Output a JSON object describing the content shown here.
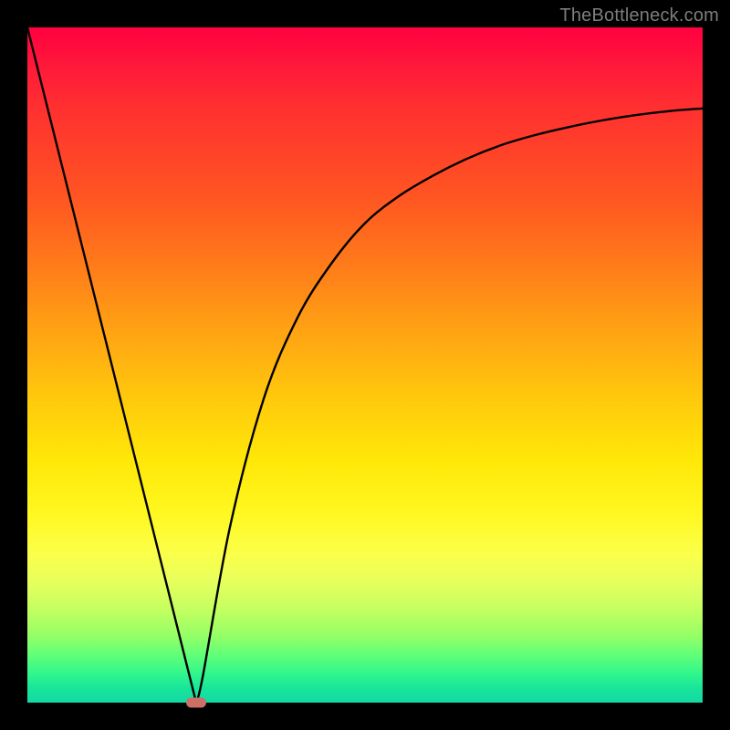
{
  "watermark": "TheBottleneck.com",
  "chart_data": {
    "type": "line",
    "title": "",
    "xlabel": "",
    "ylabel": "",
    "xlim": [
      0,
      100
    ],
    "ylim": [
      0,
      100
    ],
    "grid": false,
    "legend": false,
    "series": [
      {
        "name": "bottleneck-curve",
        "x": [
          0,
          5,
          10,
          15,
          20,
          24,
          25,
          26,
          30,
          35,
          40,
          45,
          50,
          55,
          60,
          65,
          70,
          75,
          80,
          85,
          90,
          95,
          100
        ],
        "values": [
          100,
          80,
          60,
          40,
          20,
          4,
          0,
          4,
          26,
          45,
          57,
          65,
          71,
          75,
          78,
          80.5,
          82.5,
          84,
          85.2,
          86.2,
          87,
          87.6,
          88
        ]
      }
    ],
    "marker": {
      "x": 25,
      "y": 0
    },
    "background_gradient": {
      "top": "#ff0040",
      "mid": "#ffe708",
      "bottom": "#14d9a4"
    }
  }
}
